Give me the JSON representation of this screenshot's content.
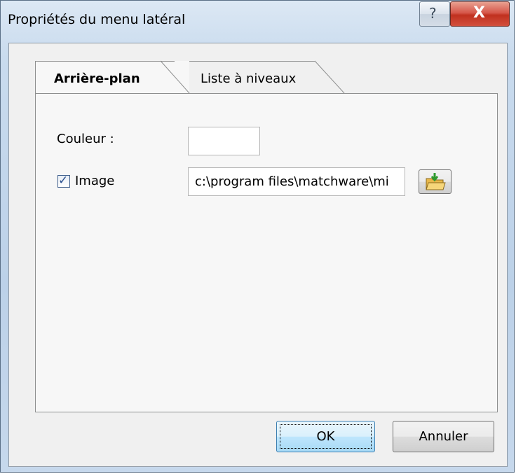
{
  "window": {
    "title": "Propriétés du menu latéral",
    "help_glyph": "?",
    "close_glyph": "X"
  },
  "tabs": [
    {
      "label": "Arrière-plan",
      "active": true
    },
    {
      "label": "Liste à niveaux",
      "active": false
    }
  ],
  "background_tab": {
    "color_label": "Couleur :",
    "image_label": "Image",
    "image_checked": true,
    "image_path": "c:\\program files\\matchware\\mi",
    "browse_icon": "folder-open-icon"
  },
  "buttons": {
    "ok_label": "OK",
    "cancel_label": "Annuler"
  },
  "colors": {
    "titlebar": "#c9dbee",
    "client": "#f0f0f0",
    "close_red": "#c0301f",
    "default_button_border": "#3c7fb1"
  }
}
